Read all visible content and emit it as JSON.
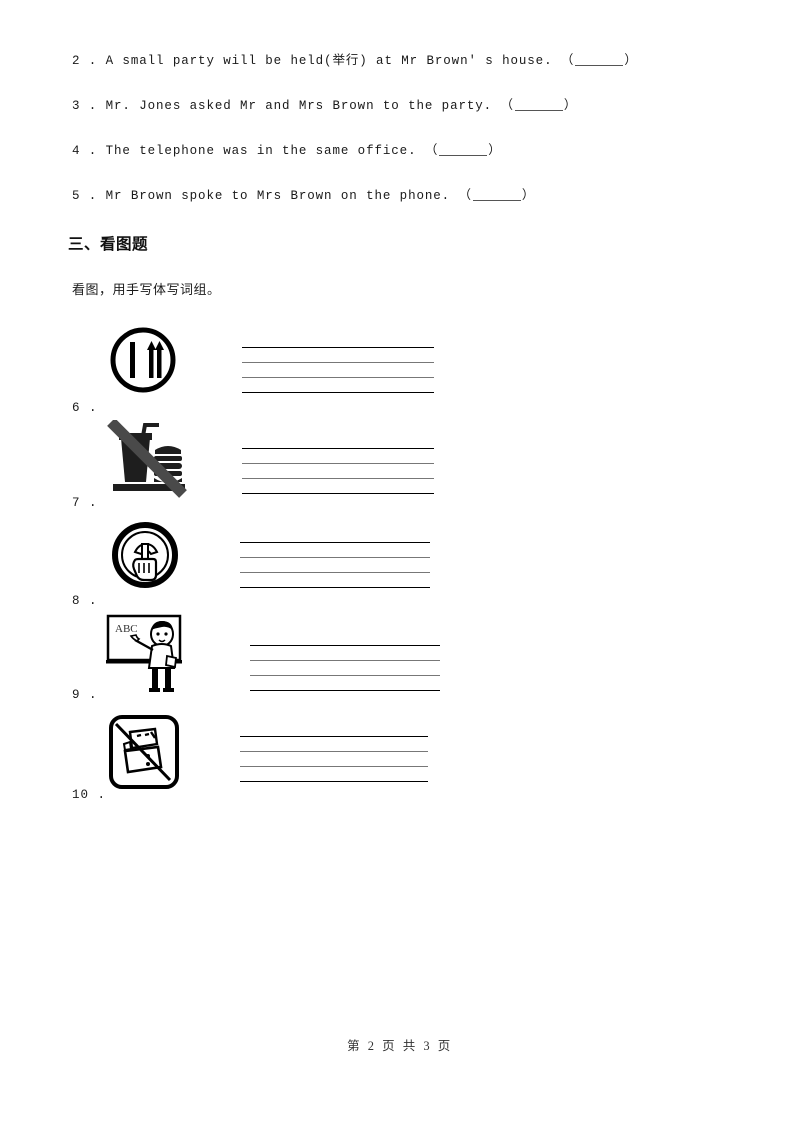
{
  "document": {
    "page_label": "第 2 页 共 3 页"
  },
  "true_false_section": {
    "items": [
      {
        "number": "2 .",
        "text": "A small party will be held(举行) at Mr Brown' s house.",
        "paren_open": "（",
        "paren_close": "）"
      },
      {
        "number": "3 .",
        "text": "Mr. Jones asked Mr and Mrs Brown to the party.",
        "paren_open": "（",
        "paren_close": "）"
      },
      {
        "number": "4 .",
        "text": "The telephone was in the same office.",
        "paren_open": "（",
        "paren_close": "）"
      },
      {
        "number": "5 .",
        "text": "Mr Brown spoke to Mrs Brown on the phone.",
        "paren_open": "（",
        "paren_close": "）"
      }
    ]
  },
  "picture_section": {
    "heading": "三、看图题",
    "instruction": "看图，用手写体写词组。",
    "items": [
      {
        "number": "6 .",
        "icon_name": "restaurant-knife-fork-circle-icon",
        "lines": 4
      },
      {
        "number": "7 .",
        "icon_name": "no-food-or-drink-icon",
        "lines": 4
      },
      {
        "number": "8 .",
        "icon_name": "no-littering-hand-circle-icon",
        "lines": 4
      },
      {
        "number": "9 .",
        "icon_name": "teacher-at-blackboard-icon",
        "blackboard_text": "ABC",
        "lines": 4
      },
      {
        "number": "10 .",
        "icon_name": "no-litter-papers-square-icon",
        "lines": 4
      }
    ]
  },
  "colors": {
    "text": "#1a1a1a",
    "rule_dark": "#000000",
    "rule_light": "#777777",
    "page_bg": "#ffffff"
  }
}
